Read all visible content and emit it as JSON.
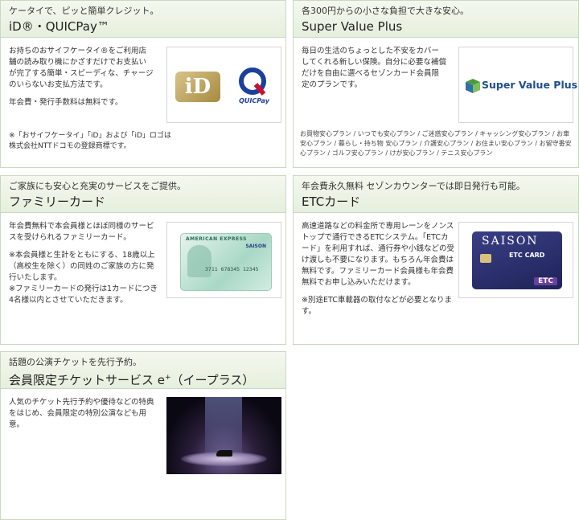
{
  "panels": {
    "id_quicpay": {
      "subtitle": "ケータイで、ピッと簡単クレジット。",
      "title": "iD®・QUICPay™",
      "body": "お持ちのおサイフケータイ®をご利用店舗の読み取り機にかざすだけでお支払いが完了する簡単・スピーディな、チャージのいらないお支払方法です。",
      "fee": "年会費・発行手数料は無料です。",
      "note": "※「おサイフケータイ」「iD」および「iD」ロゴは株式会社NTTドコモの登録商標です。",
      "logo_id": "iD",
      "logo_quicpay": "QUICPay"
    },
    "super_value": {
      "subtitle": "各300円からの小さな負担で大きな安心。",
      "title": "Super Value Plus",
      "body": "毎日の生活のちょっとした不安をカバーしてくれる新しい保険。自分に必要な補償だけを自由に選べるセゾンカード会員限定のプランです。",
      "logo_text": "Super Value Plus",
      "links": "お買物安心プラン / いつでも安心プラン / ご迷惑安心プラン / キャッシング安心プラン / お車安心プラン / 暮らし・持ち物 安心プラン / 介護安心プラン / お住まい安心プラン / お留守番安心プラン / ゴルフ安心プラン / けが安心プラン / テニス安心プラン"
    },
    "family": {
      "subtitle": "ご家族にも安心と充実のサービスをご提供。",
      "title": "ファミリーカード",
      "body": "年会費無料で本会員様とほぼ同様のサービスを受けられるファミリーカード。",
      "note1": "※本会員様と生計をともにする、18歳以上（高校生を除く）の同姓のご家族の方に発行いたします。",
      "note2": "※ファミリーカードの発行は1カードにつき4名様以内とさせていただきます。",
      "card_brand": "AMERICAN EXPRESS",
      "card_issuer": "SAISON",
      "card_number": "3711 678345 12345"
    },
    "etc": {
      "subtitle": "年会費永久無料 セゾンカウンターでは即日発行も可能。",
      "title": "ETCカード",
      "body": "高速道路などの料金所で専用レーンをノンストップで通行できるETCシステム。「ETCカード」を利用すれば、通行券や小銭などの受け渡しも不要になります。もちろん年会費は無料です。ファミリーカード会員様も年会費無料でお申し込みいただけます。",
      "note": "※別途ETC車載器の取付などが必要となります。",
      "card_brand": "SAISON",
      "card_type": "ETC CARD",
      "card_badge": "ETC"
    },
    "eplus": {
      "subtitle": "話題の公演チケットを先行予約。",
      "title_main": "会員限定チケットサービス e",
      "title_sup": "+",
      "title_tail": "（イープラス）",
      "body": "人気のチケット先行予約や優待などの特典をはじめ、会員限定の特別公演なども用意。"
    }
  },
  "colors": {
    "header_bg": "#e8f0df",
    "border": "#c9d8c2",
    "saison_navy": "#2a2f6e"
  }
}
